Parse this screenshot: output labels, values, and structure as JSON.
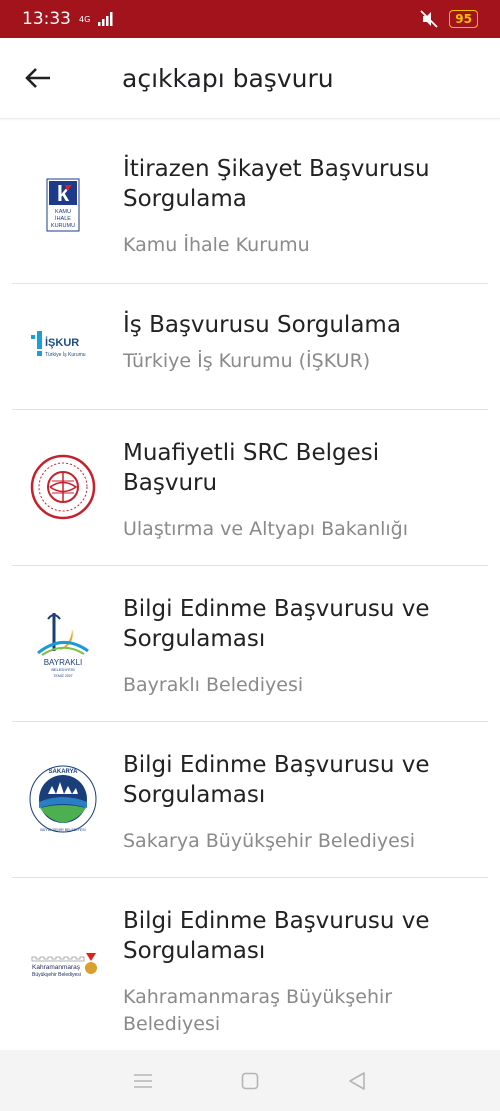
{
  "status_bar": {
    "time": "13:33",
    "network_label": "4G",
    "battery": "95"
  },
  "app_bar": {
    "title": "açıkkapı başvuru"
  },
  "items": [
    {
      "title": "İtirazen Şikayet Başvurusu Sorgulama",
      "subtitle": "Kamu İhale Kurumu",
      "logo": "kamu-ihale-kurumu-logo",
      "logo_text": [
        "KAMU",
        "İHALE",
        "KURUMU"
      ]
    },
    {
      "title": "İş Başvurusu Sorgulama",
      "subtitle": "Türkiye İş Kurumu (İŞKUR)",
      "logo": "iskur-logo",
      "logo_text": [
        "İŞKUR",
        "Türkiye İş Kurumu"
      ]
    },
    {
      "title": "Muafiyetli SRC Belgesi Başvuru",
      "subtitle": "Ulaştırma ve Altyapı Bakanlığı",
      "logo": "ulastirma-bakanligi-logo",
      "logo_text": []
    },
    {
      "title": "Bilgi Edinme Başvurusu ve Sorgulaması",
      "subtitle": "Bayraklı Belediyesi",
      "logo": "bayrakli-belediyesi-logo",
      "logo_text": [
        "BAYRAKLI",
        "BELEDİYESİ",
        "TEMİZ 2007"
      ]
    },
    {
      "title": "Bilgi Edinme Başvurusu ve Sorgulaması",
      "subtitle": "Sakarya Büyükşehir Belediyesi",
      "logo": "sakarya-belediyesi-logo",
      "logo_text": [
        "SAKARYA",
        "BÜYÜKŞEHİR BELEDİYESİ"
      ]
    },
    {
      "title": "Bilgi Edinme Başvurusu ve Sorgulaması",
      "subtitle": "Kahramanmaraş Büyükşehir Belediyesi",
      "logo": "kahramanmaras-belediyesi-logo",
      "logo_text": [
        "Kahramanmaraş",
        "Büyükşehir Belediyesi"
      ]
    }
  ],
  "nav_bar": {
    "buttons": [
      "menu-icon",
      "home-square-icon",
      "back-triangle-icon"
    ]
  },
  "colors": {
    "status_bar": "#a3131b",
    "battery": "#f2c200",
    "subtitle": "#8a8a8a"
  }
}
